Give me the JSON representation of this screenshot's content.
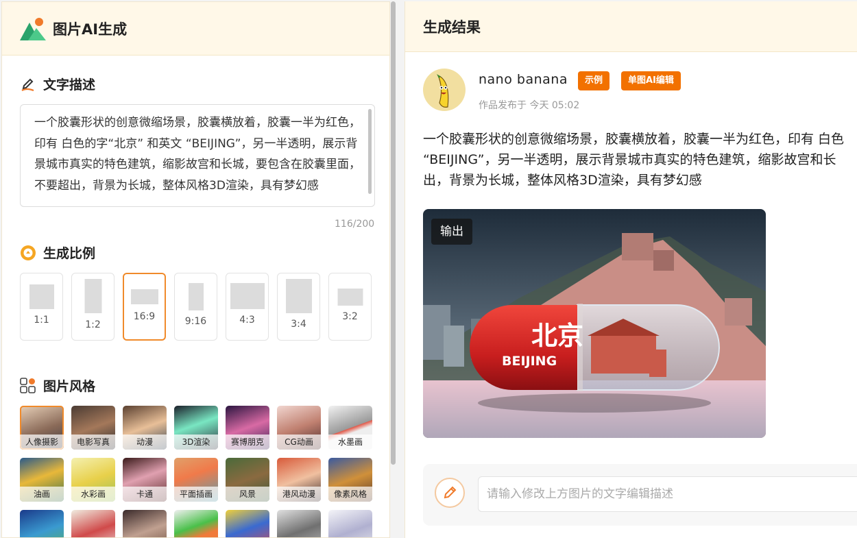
{
  "app": {
    "title": "图片AI生成"
  },
  "description": {
    "section_title": "文字描述",
    "text": "一个胶囊形状的创意微缩场景，胶囊横放着，胶囊一半为红色，印有 白色的字“北京” 和英文 “BEIJING”，另一半透明，展示背景城市真实的特色建筑，缩影故宫和长城，要包含在胶囊里面，不要超出，背景为长城，整体风格3D渲染，具有梦幻感",
    "char_count": "116/200"
  },
  "ratio": {
    "section_title": "生成比例",
    "selected": "16:9",
    "options": [
      "1:1",
      "1:2",
      "16:9",
      "9:16",
      "4:3",
      "3:4",
      "3:2"
    ]
  },
  "style": {
    "section_title": "图片风格",
    "selected": "人像摄影",
    "options": [
      "人像摄影",
      "电影写真",
      "动漫",
      "3D渲染",
      "赛博朋克",
      "CG动画",
      "水墨画",
      "油画",
      "水彩画",
      "卡通",
      "平面插画",
      "风景",
      "港风动漫",
      "像素风格",
      "",
      "",
      "",
      "",
      "",
      "",
      ""
    ]
  },
  "result": {
    "header": "生成结果",
    "user_name": "nano banana",
    "badges": [
      "示例",
      "单图AI编辑"
    ],
    "published": "作品发布于 今天 05:02",
    "prompt_lines": [
      "一个胶囊形状的创意微缩场景，胶囊横放着，胶囊一半为红色，印有 白色",
      "“BEIJING”，另一半透明，展示背景城市真实的特色建筑，缩影故宫和长",
      "出，背景为长城，整体风格3D渲染，具有梦幻感"
    ],
    "output_tag": "输出",
    "image_text_cn": "北京",
    "image_text_en": "BEIJING"
  },
  "edit": {
    "placeholder": "请输入修改上方图片的文字编辑描述"
  },
  "colors": {
    "accent": "#f08a2a",
    "badge": "#f27100",
    "header_bg": "#fff8e8"
  }
}
